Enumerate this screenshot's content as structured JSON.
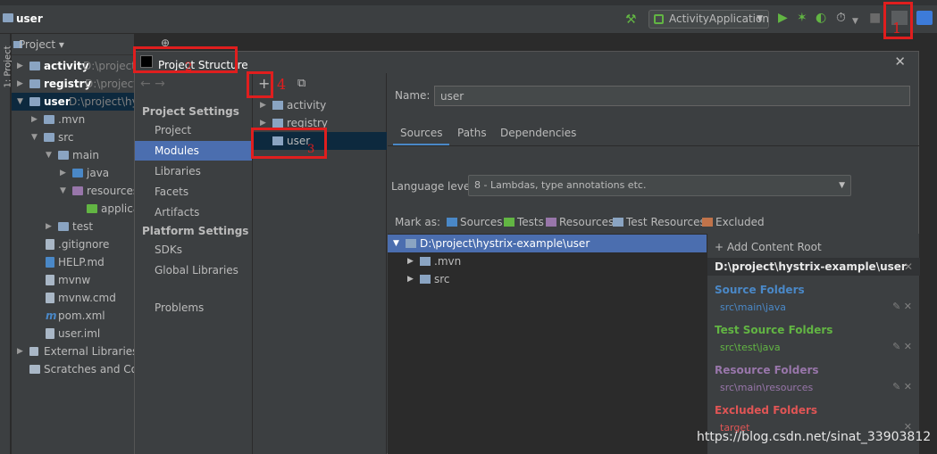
{
  "titlebar": {
    "project_name": "user",
    "run_config": "ActivityApplication"
  },
  "sidebar": {
    "tool_window": "1: Project"
  },
  "project_panel": {
    "header": "Project",
    "items": [
      {
        "name": "activity",
        "path": "D:\\project\\"
      },
      {
        "name": "registry",
        "path": "D:\\project\\"
      },
      {
        "name": "user",
        "path": "D:\\project\\hystr"
      },
      {
        "name": ".mvn"
      },
      {
        "name": "src"
      },
      {
        "name": "main"
      },
      {
        "name": "java"
      },
      {
        "name": "resources"
      },
      {
        "name": "applicat"
      },
      {
        "name": "test"
      },
      {
        "name": ".gitignore"
      },
      {
        "name": "HELP.md"
      },
      {
        "name": "mvnw"
      },
      {
        "name": "mvnw.cmd"
      },
      {
        "name": "pom.xml"
      },
      {
        "name": "user.iml"
      },
      {
        "name": "External Libraries"
      },
      {
        "name": "Scratches and Cons"
      }
    ]
  },
  "dialog": {
    "title": "Project Structure",
    "nav": {
      "project_settings_head": "Project Settings",
      "project_settings": [
        "Project",
        "Modules",
        "Libraries",
        "Facets",
        "Artifacts"
      ],
      "platform_settings_head": "Platform Settings",
      "platform_settings": [
        "SDKs",
        "Global Libraries"
      ],
      "problems": "Problems"
    },
    "modules": [
      "activity",
      "registry",
      "user"
    ],
    "name_label": "Name:",
    "name_value": "user",
    "tabs": [
      "Sources",
      "Paths",
      "Dependencies"
    ],
    "language_level_label": "Language level:",
    "language_level_value": "8 - Lambdas, type annotations etc.",
    "mark_as_label": "Mark as:",
    "mark_as": [
      "Sources",
      "Tests",
      "Resources",
      "Test Resources",
      "Excluded"
    ],
    "content_tree": [
      {
        "name": "D:\\project\\hystrix-example\\user"
      },
      {
        "name": ".mvn"
      },
      {
        "name": "src"
      }
    ],
    "roots": {
      "add_content_root": "+ Add Content Root",
      "root_path": "D:\\project\\hystrix-example\\user",
      "source_head": "Source Folders",
      "source_item": "src\\main\\java",
      "test_head": "Test Source Folders",
      "test_item": "src\\test\\java",
      "resource_head": "Resource Folders",
      "resource_item": "src\\main\\resources",
      "excluded_head": "Excluded Folders",
      "excluded_item": "target"
    }
  },
  "annotations": [
    "1",
    "2",
    "3",
    "4"
  ],
  "watermark": "https://blog.csdn.net/sinat_33903812",
  "colors": {
    "accent": "#4b6eaf",
    "source": "#4a88c7",
    "test": "#62b543",
    "resource": "#9876aa",
    "excluded": "#e05555",
    "highlight": "#e01e1e"
  }
}
